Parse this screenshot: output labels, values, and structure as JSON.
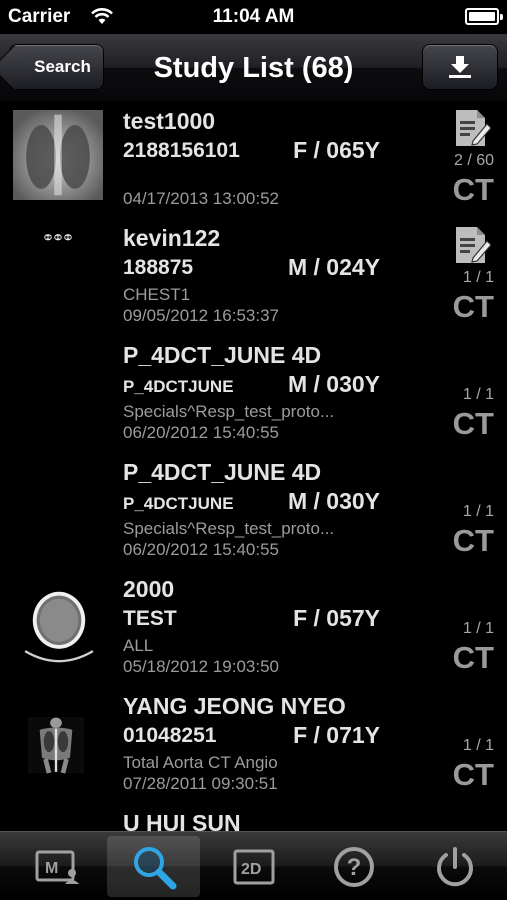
{
  "status_bar": {
    "carrier": "Carrier",
    "time": "11:04 AM"
  },
  "nav": {
    "back_label": "Search",
    "title": "Study List (68)"
  },
  "studies": [
    {
      "name": "test1000",
      "patient_id": "2188156101",
      "sex_age": "F / 065Y",
      "description": "",
      "date": "04/17/2013 13:00:52",
      "count": "2 / 60",
      "modality": "CT",
      "has_note": true
    },
    {
      "name": "kevin122",
      "patient_id": "188875",
      "sex_age": "M / 024Y",
      "description": "CHEST1",
      "date": "09/05/2012 16:53:37",
      "count": "1 / 1",
      "modality": "CT",
      "has_note": true
    },
    {
      "name": "P_4DCT_JUNE 4D",
      "patient_id": "P_4DCTJUNE",
      "sex_age": "M / 030Y",
      "description": "Specials^Resp_test_proto...",
      "date": "06/20/2012 15:40:55",
      "count": "1 / 1",
      "modality": "CT",
      "has_note": false
    },
    {
      "name": "P_4DCT_JUNE 4D",
      "patient_id": "P_4DCTJUNE",
      "sex_age": "M / 030Y",
      "description": "Specials^Resp_test_proto...",
      "date": "06/20/2012 15:40:55",
      "count": "1 / 1",
      "modality": "CT",
      "has_note": false
    },
    {
      "name": "2000",
      "patient_id": "TEST",
      "sex_age": "F / 057Y",
      "description": "ALL",
      "date": "05/18/2012 19:03:50",
      "count": "1 / 1",
      "modality": "CT",
      "has_note": false
    },
    {
      "name": "YANG JEONG NYEO",
      "patient_id": "01048251",
      "sex_age": "F / 071Y",
      "description": "Total Aorta CT Angio",
      "date": "07/28/2011 09:30:51",
      "count": "1 / 1",
      "modality": "CT",
      "has_note": false
    },
    {
      "name": "U HUI SUN",
      "patient_id": "",
      "sex_age": "",
      "description": "",
      "date": "",
      "count": "",
      "modality": "",
      "has_note": false
    }
  ],
  "tabs": [
    {
      "icon": "patient-monitor-icon",
      "active": false
    },
    {
      "icon": "search-icon",
      "active": true
    },
    {
      "icon": "2d-view-icon",
      "label": "2D",
      "active": false
    },
    {
      "icon": "help-icon",
      "label": "?",
      "active": false
    },
    {
      "icon": "power-icon",
      "active": false
    }
  ]
}
